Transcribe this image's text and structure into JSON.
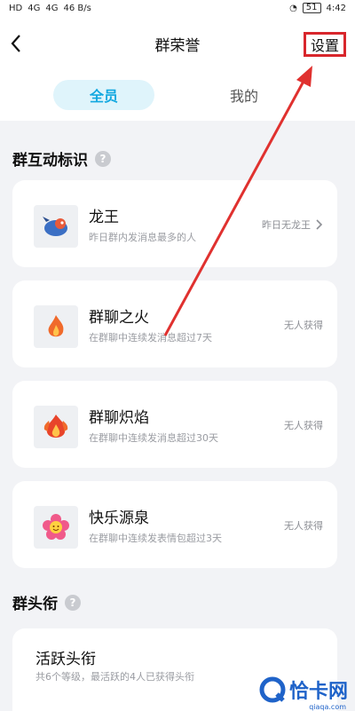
{
  "status_bar": {
    "left": [
      "HD",
      "4G",
      "4G",
      "46 B/s"
    ],
    "battery": "51",
    "time": "4:42"
  },
  "header": {
    "title": "群荣誉",
    "settings_label": "设置"
  },
  "tabs": [
    {
      "label": "全员",
      "active": true
    },
    {
      "label": "我的",
      "active": false
    }
  ],
  "interaction_section": {
    "title": "群互动标识",
    "cards": [
      {
        "name": "龙王",
        "desc": "昨日群内发消息最多的人",
        "status": "昨日无龙王",
        "icon": "dragon-icon"
      },
      {
        "name": "群聊之火",
        "desc": "在群聊中连续发消息超过7天",
        "status": "无人获得",
        "icon": "fire-icon"
      },
      {
        "name": "群聊炽焰",
        "desc": "在群聊中连续发消息超过30天",
        "status": "无人获得",
        "icon": "blaze-icon"
      },
      {
        "name": "快乐源泉",
        "desc": "在群聊中连续发表情包超过3天",
        "status": "无人获得",
        "icon": "flower-icon"
      }
    ]
  },
  "title_section": {
    "title": "群头衔",
    "card_title": "活跃头衔",
    "card_desc": "共6个等级，最活跃的4人已获得头衔"
  },
  "watermark": {
    "text": "恰卡网",
    "url": "qiaqa.com"
  },
  "colors": {
    "accent": "#12a8e0",
    "annotation": "#d8262c"
  }
}
